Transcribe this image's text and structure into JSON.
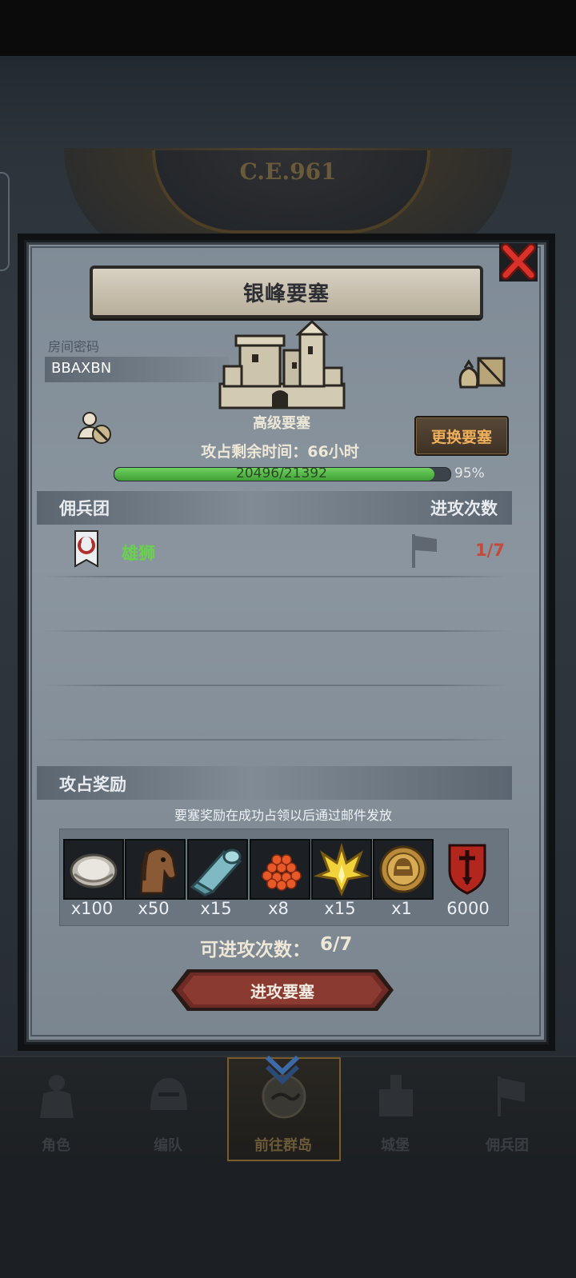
{
  "background": {
    "era_label": "C.E.961"
  },
  "modal": {
    "title": "银峰要塞",
    "room_password_label": "房间密码",
    "room_password": "BBAXBN",
    "fortress_level": "高级要塞",
    "change_button": "更换要塞",
    "time_left": "攻占剩余时间：66小时",
    "progress": {
      "text": "20496/21392",
      "current": 20496,
      "total": 21392,
      "percent_label": "95%",
      "percent": 95
    },
    "mercenary_header": "佣兵团",
    "attacks_header": "进攻次数",
    "mercenaries": [
      {
        "name": "雄狮",
        "attacks": "1/7"
      }
    ],
    "rewards_header": "攻占奖励",
    "rewards_note": "要塞奖励在成功占领以后通过邮件发放",
    "rewards": [
      {
        "icon": "oyster-icon",
        "qty": "x100"
      },
      {
        "icon": "horse-icon",
        "qty": "x50"
      },
      {
        "icon": "cloth-roll-icon",
        "qty": "x15"
      },
      {
        "icon": "roe-icon",
        "qty": "x8"
      },
      {
        "icon": "golden-crest-icon",
        "qty": "x15"
      },
      {
        "icon": "knight-medal-icon",
        "qty": "x1"
      },
      {
        "icon": "sword-shield-icon",
        "qty": "6000"
      }
    ],
    "available_attacks_label": "可进攻次数：",
    "available_attacks_value": "6/7",
    "attack_button": "进攻要塞"
  },
  "nav": {
    "items": [
      {
        "label": "角色",
        "icon": "knight-icon"
      },
      {
        "label": "编队",
        "icon": "helmet-icon"
      },
      {
        "label": "前往群岛",
        "icon": "compass-map-icon",
        "active": true
      },
      {
        "label": "城堡",
        "icon": "castle-icon"
      },
      {
        "label": "佣兵团",
        "icon": "mercenary-icon"
      }
    ]
  },
  "colors": {
    "accent_green": "#68d34a",
    "accent_red": "#c44a3c",
    "button_orange": "#f0b05a"
  }
}
